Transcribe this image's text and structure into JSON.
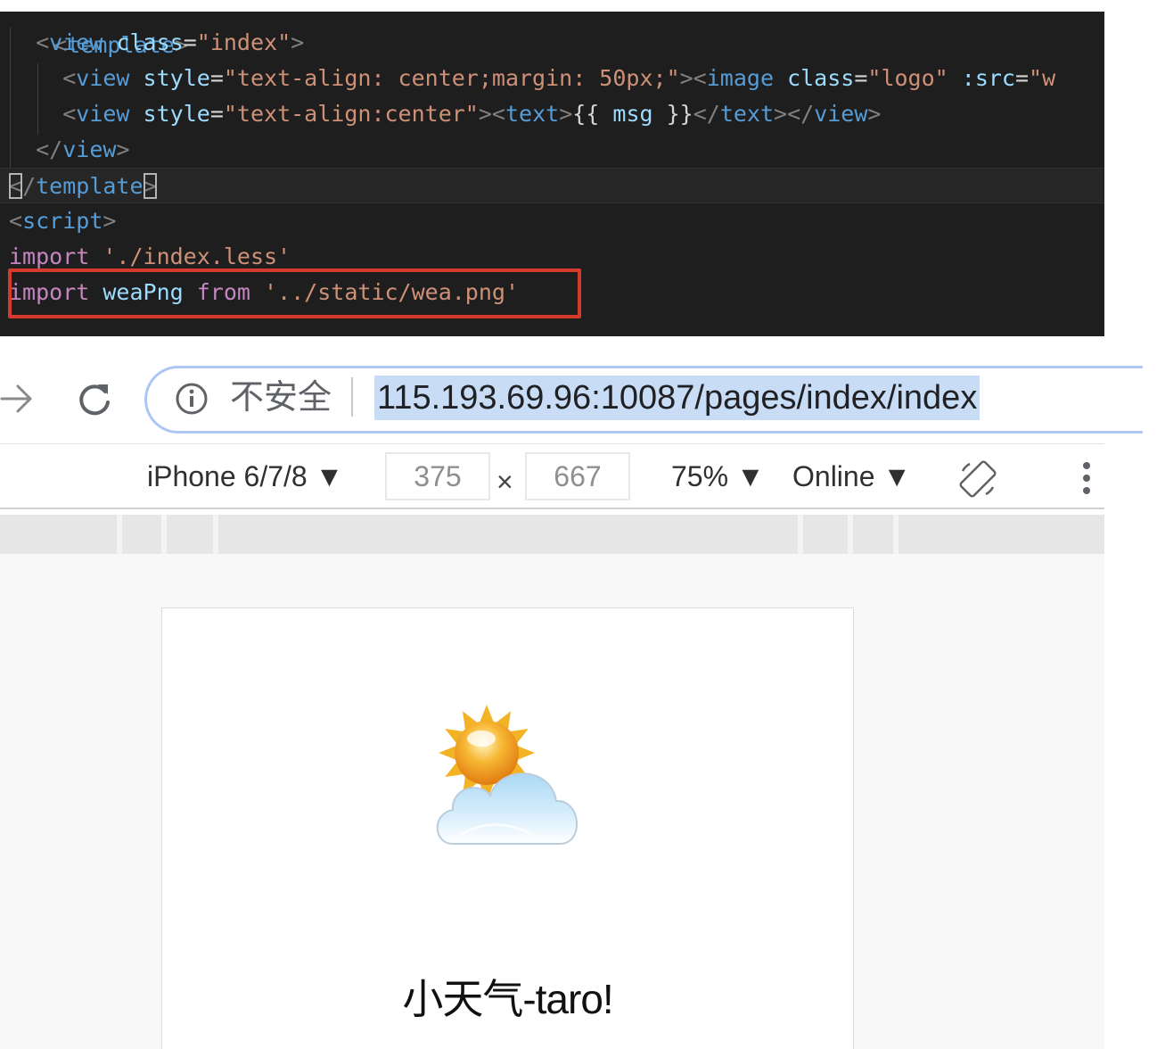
{
  "editor": {
    "lines": [
      [
        {
          "c": "t-punct",
          "t": "  <"
        },
        {
          "c": "t-tag",
          "t": "view"
        },
        {
          "c": "t-plain",
          "t": " "
        },
        {
          "c": "t-attr",
          "t": "class"
        },
        {
          "c": "t-plain",
          "t": "="
        },
        {
          "c": "t-str",
          "t": "\"index\""
        },
        {
          "c": "t-punct",
          "t": ">"
        }
      ],
      [
        {
          "c": "t-punct",
          "t": "    <"
        },
        {
          "c": "t-tag",
          "t": "view"
        },
        {
          "c": "t-plain",
          "t": " "
        },
        {
          "c": "t-attr",
          "t": "style"
        },
        {
          "c": "t-plain",
          "t": "="
        },
        {
          "c": "t-str",
          "t": "\"text-align: center;margin: 50px;\""
        },
        {
          "c": "t-punct",
          "t": "><"
        },
        {
          "c": "t-tag",
          "t": "image"
        },
        {
          "c": "t-plain",
          "t": " "
        },
        {
          "c": "t-attr",
          "t": "class"
        },
        {
          "c": "t-plain",
          "t": "="
        },
        {
          "c": "t-str",
          "t": "\"logo\""
        },
        {
          "c": "t-plain",
          "t": " "
        },
        {
          "c": "t-attr",
          "t": ":src"
        },
        {
          "c": "t-plain",
          "t": "="
        },
        {
          "c": "t-str",
          "t": "\"w"
        }
      ],
      [
        {
          "c": "t-punct",
          "t": "    <"
        },
        {
          "c": "t-tag",
          "t": "view"
        },
        {
          "c": "t-plain",
          "t": " "
        },
        {
          "c": "t-attr",
          "t": "style"
        },
        {
          "c": "t-plain",
          "t": "="
        },
        {
          "c": "t-str",
          "t": "\"text-align:center\""
        },
        {
          "c": "t-punct",
          "t": "><"
        },
        {
          "c": "t-tag",
          "t": "text"
        },
        {
          "c": "t-punct",
          "t": ">"
        },
        {
          "c": "t-plain",
          "t": "{{ "
        },
        {
          "c": "t-var",
          "t": "msg"
        },
        {
          "c": "t-plain",
          "t": " }}"
        },
        {
          "c": "t-punct",
          "t": "</"
        },
        {
          "c": "t-tag",
          "t": "text"
        },
        {
          "c": "t-punct",
          "t": "></"
        },
        {
          "c": "t-tag",
          "t": "view"
        },
        {
          "c": "t-punct",
          "t": ">"
        }
      ],
      [
        {
          "c": "t-punct",
          "t": "  </"
        },
        {
          "c": "t-tag",
          "t": "view"
        },
        {
          "c": "t-punct",
          "t": ">"
        }
      ],
      [
        {
          "c": "t-punct bracket-box",
          "t": "<"
        },
        {
          "c": "t-punct",
          "t": "/"
        },
        {
          "c": "t-tag",
          "t": "template"
        },
        {
          "c": "t-punct bracket-box",
          "t": ">"
        }
      ],
      [
        {
          "c": "t-punct",
          "t": "<"
        },
        {
          "c": "t-tag",
          "t": "script"
        },
        {
          "c": "t-punct",
          "t": ">"
        }
      ],
      [
        {
          "c": "t-kw",
          "t": "import"
        },
        {
          "c": "t-plain",
          "t": " "
        },
        {
          "c": "t-str",
          "t": "'./index.less'"
        }
      ],
      [
        {
          "c": "t-kw",
          "t": "import"
        },
        {
          "c": "t-plain",
          "t": " "
        },
        {
          "c": "t-var",
          "t": "weaPng"
        },
        {
          "c": "t-plain",
          "t": " "
        },
        {
          "c": "t-kw",
          "t": "from"
        },
        {
          "c": "t-plain",
          "t": " "
        },
        {
          "c": "t-str",
          "t": "'../static/wea.png'"
        }
      ]
    ]
  },
  "browser": {
    "security_label": "不安全",
    "url": "115.193.69.96:10087/pages/index/index"
  },
  "devtools": {
    "device": "iPhone 6/7/8 ▼",
    "width": "375",
    "times": "×",
    "height": "667",
    "zoom": "75% ▼",
    "network": "Online ▼"
  },
  "app": {
    "message": "小天气-taro!"
  },
  "icons": {
    "forward": "forward-arrow-icon",
    "reload": "reload-icon",
    "info": "info-icon",
    "rotate": "rotate-icon",
    "more": "more-vertical-icon",
    "weather": "partly-cloudy-icon"
  },
  "colors": {
    "editor_bg": "#1e1e1e",
    "highlight_box": "#d53a2b",
    "url_selection": "#c9dcf6",
    "omnibox_border": "#aec6f4"
  }
}
